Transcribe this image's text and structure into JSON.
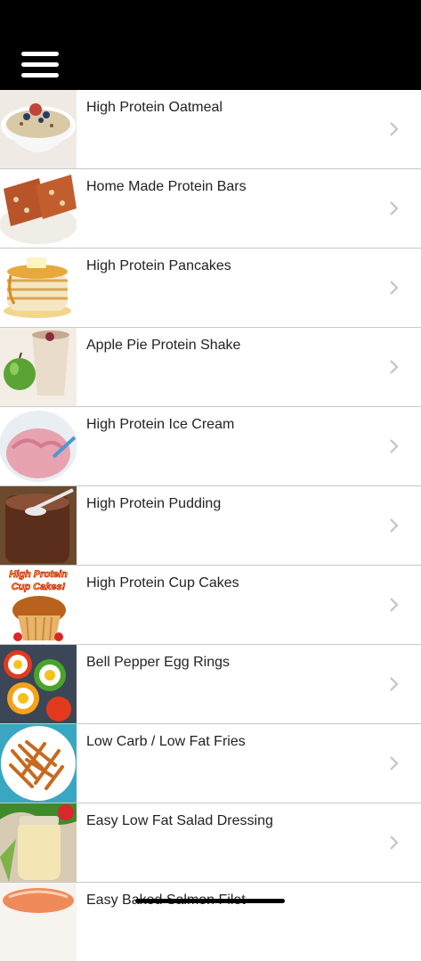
{
  "header": {
    "menu_icon": "hamburger-menu-icon"
  },
  "recipes": [
    {
      "title": "High Protein Oatmeal",
      "thumb": "oatmeal"
    },
    {
      "title": "Home Made Protein Bars",
      "thumb": "bars"
    },
    {
      "title": "High Protein Pancakes",
      "thumb": "pancakes"
    },
    {
      "title": "Apple Pie Protein Shake",
      "thumb": "shake"
    },
    {
      "title": "High Protein Ice Cream",
      "thumb": "icecream"
    },
    {
      "title": "High Protein Pudding",
      "thumb": "pudding"
    },
    {
      "title": "High Protein Cup Cakes",
      "thumb": "cupcakes",
      "thumb_text": [
        "High Protein",
        "Cup Cakes!"
      ]
    },
    {
      "title": "Bell Pepper Egg Rings",
      "thumb": "eggrings"
    },
    {
      "title": "Low Carb / Low Fat Fries",
      "thumb": "fries"
    },
    {
      "title": "Easy Low Fat Salad Dressing",
      "thumb": "dressing"
    },
    {
      "title": "Easy Baked Salmon Filet",
      "thumb": "salmon"
    }
  ],
  "colors": {
    "header_bg": "#000000",
    "separator": "#c8c8cc",
    "chevron": "#c4c4c7",
    "cupcake_text": "#ffd21a"
  }
}
